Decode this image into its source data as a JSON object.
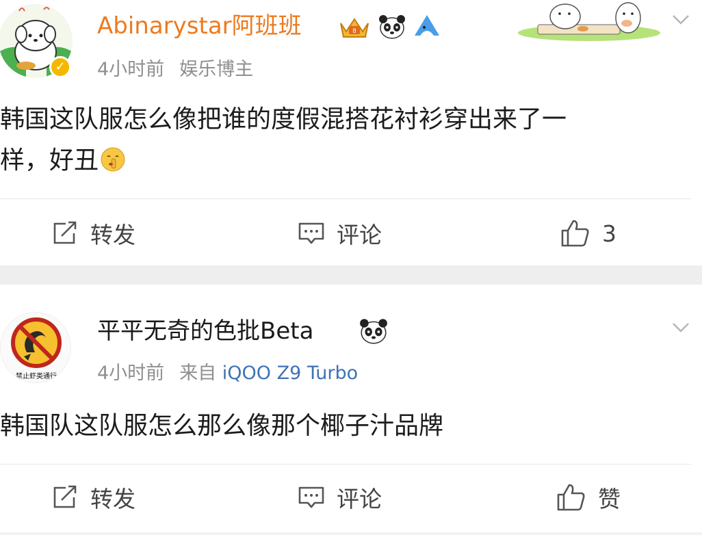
{
  "posts": [
    {
      "username": "Abinarystar阿班班",
      "time": "4小时前",
      "tag": "娱乐博主",
      "content_lines": [
        "韩国这队服怎么像把谁的度假混搭花衬衫穿出来了一",
        "样，好丑"
      ],
      "actions": {
        "repost": "转发",
        "comment": "评论",
        "like": "3"
      },
      "icons": [
        "avatar-dog",
        "verified-badge",
        "crown-badge",
        "panda-badge",
        "shark-badge",
        "sticker-decoration"
      ]
    },
    {
      "username": "平平无奇的色批Beta",
      "time": "4小时前",
      "source_prefix": "来自",
      "device": "iQOO Z9 Turbo",
      "content": "韩国队这队服怎么那么像那个椰子汁品牌",
      "avatar_text": "禁止虾类通行",
      "actions": {
        "repost": "转发",
        "comment": "评论",
        "like": "赞"
      },
      "icons": [
        "avatar-no-shrimp",
        "panda-badge"
      ]
    }
  ],
  "colors": {
    "vip_name": "#ec7a1f",
    "device_link": "#3f72b5",
    "meta": "#8f8f8f",
    "separator": "#eeeeee"
  }
}
